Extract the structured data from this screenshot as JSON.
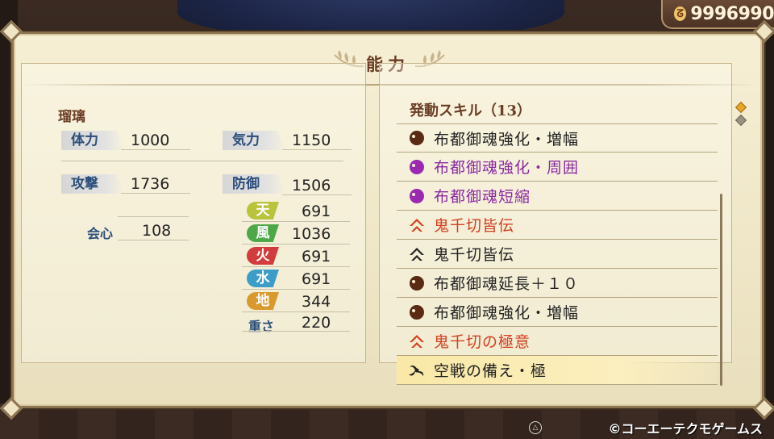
{
  "currency": {
    "icon": "coin-icon",
    "symbol": "ᘔ",
    "value": "9996990"
  },
  "panel": {
    "title": "能力"
  },
  "character": {
    "name": "瑠璃",
    "stats": {
      "stamina": {
        "label": "体力",
        "value": "1000"
      },
      "ki": {
        "label": "気力",
        "value": "1150"
      },
      "attack": {
        "label": "攻撃",
        "value": "1736"
      },
      "defense": {
        "label": "防御",
        "value": "1506"
      },
      "critical": {
        "label": "会心",
        "value": "108"
      }
    },
    "elements": [
      {
        "label": "天",
        "value": "691",
        "color": "#b9c33c"
      },
      {
        "label": "風",
        "value": "1036",
        "color": "#4ea84a"
      },
      {
        "label": "火",
        "value": "691",
        "color": "#d23c3c"
      },
      {
        "label": "水",
        "value": "691",
        "color": "#3c9ec8"
      },
      {
        "label": "地",
        "value": "344",
        "color": "#d89a2e"
      }
    ],
    "weight": {
      "label": "重さ",
      "value": "220"
    }
  },
  "skills": {
    "header": "発動スキル（13）",
    "items": [
      {
        "name": "布都御魂強化・増幅",
        "icon": "magatama-icon",
        "color": "#222222",
        "icon_color": "#5a2a12"
      },
      {
        "name": "布都御魂強化・周囲",
        "icon": "magatama-icon",
        "color": "#8a2aa0",
        "icon_color": "#9a2ab0"
      },
      {
        "name": "布都御魂短縮",
        "icon": "magatama-icon",
        "color": "#8a2aa0",
        "icon_color": "#9a2ab0"
      },
      {
        "name": "鬼千切皆伝",
        "icon": "chevron-mark-icon",
        "color": "#d2401e",
        "icon_color": "#d2401e"
      },
      {
        "name": "鬼千切皆伝",
        "icon": "chevron-mark-icon",
        "color": "#222222",
        "icon_color": "#222222"
      },
      {
        "name": "布都御魂延長＋１０",
        "icon": "magatama-icon",
        "color": "#222222",
        "icon_color": "#5a2a12"
      },
      {
        "name": "布都御魂強化・増幅",
        "icon": "magatama-icon",
        "color": "#222222",
        "icon_color": "#5a2a12"
      },
      {
        "name": "鬼千切の極意",
        "icon": "chevron-mark-icon",
        "color": "#d2401e",
        "icon_color": "#d2401e"
      },
      {
        "name": "空戦の備え・極",
        "icon": "triskelion-icon",
        "color": "#222222",
        "icon_color": "#222222",
        "selected": true
      }
    ]
  },
  "footer": {
    "button_hint": "△",
    "copyright": "©コーエーテクモゲームス"
  }
}
